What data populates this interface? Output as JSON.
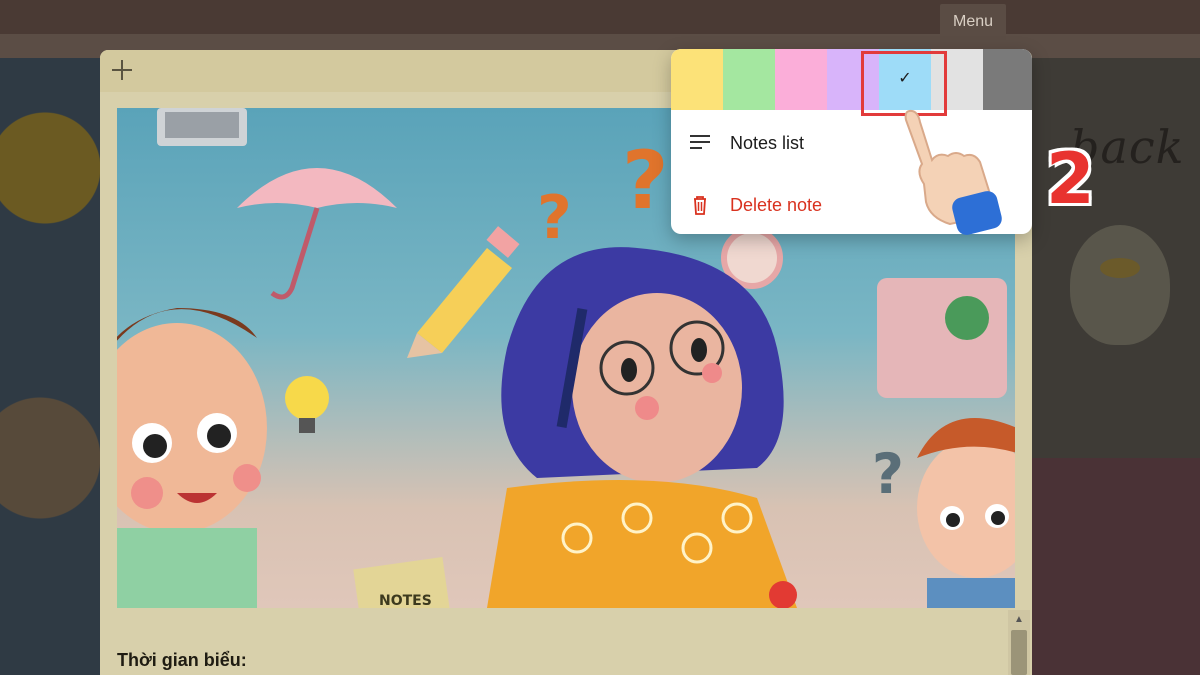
{
  "background": {
    "menu_label": "Menu",
    "script_text": "back"
  },
  "note": {
    "new_note_icon": "plus-icon",
    "body_heading": "Thời gian biểu:",
    "image_text": "NOTES"
  },
  "color_menu": {
    "swatches": [
      {
        "name": "yellow",
        "color": "#fce278"
      },
      {
        "name": "green",
        "color": "#a4e7a0"
      },
      {
        "name": "pink",
        "color": "#fbaed9"
      },
      {
        "name": "purple",
        "color": "#d8b4fa"
      },
      {
        "name": "blue",
        "color": "#9edcf8",
        "selected": true
      },
      {
        "name": "gray",
        "color": "#e2e2e2"
      },
      {
        "name": "charcoal",
        "color": "#7a7a7a"
      }
    ],
    "selected_mark": "✓",
    "items": [
      {
        "label": "Notes list",
        "icon": "list-icon",
        "color": "#1c1c1c"
      },
      {
        "label": "Delete note",
        "icon": "trash-icon",
        "color": "#d9321f"
      }
    ]
  },
  "overlay": {
    "step_number": "2",
    "accent_color": "#e8332f"
  }
}
